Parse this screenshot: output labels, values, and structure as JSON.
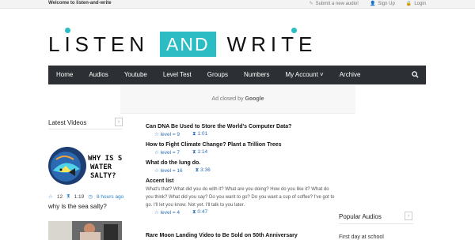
{
  "topbar": {
    "welcome": "Welcome to listen-and-write",
    "submit": "Submit a new audio!",
    "signup": "Sign Up",
    "login": "Login"
  },
  "logo": {
    "word1": "LISTEN",
    "word2": "AND",
    "word3": "WRITE",
    "accent": "#2bbcc4"
  },
  "nav": {
    "items": [
      "Home",
      "Audios",
      "Youtube",
      "Level Test",
      "Groups",
      "Numbers",
      "My Account",
      "Archive"
    ],
    "account_caret": "˅"
  },
  "ad": {
    "prefix": "Ad closed by",
    "brand": "Google"
  },
  "latest_videos": {
    "title": "Latest Videos",
    "arrow": "›",
    "thumb_text": "WHY IS SEA WATER SALTY?",
    "likes": "12",
    "duration": "1:19",
    "ago": "8 hours ago",
    "video_title": "why is the sea salty?"
  },
  "articles": [
    {
      "title": "Can DNA Be Used to Store the World's Computer Data?",
      "level": "level = 9",
      "time": "1:01"
    },
    {
      "title": "How to Fight Climate Change? Plant a Trillion Trees",
      "level": "level = 7",
      "time": "1:14"
    },
    {
      "title": "What do the lung do.",
      "level": "level = 16",
      "time": "3:36"
    },
    {
      "title": "Accent list",
      "desc": "What's that? What did you do with it? What are you doing? How do you like it? What do you think? What did you say? Do you want to go? Do you want a cup of coffee? I've got to go. I'll let you know. Not yet. I'll talk to you later.",
      "level": "level = 4",
      "time": "0:47"
    }
  ],
  "last_article": "Rare Moon Landing Video to Be Sold on 50th Anniversary",
  "popular_audios": {
    "title": "Popular Audios",
    "arrow": "›",
    "first_item": "First day at school"
  }
}
